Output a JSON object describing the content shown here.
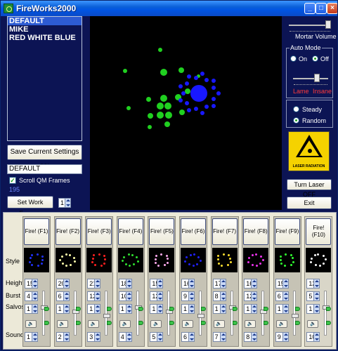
{
  "window": {
    "title": "FireWorks2000",
    "minimize": "_",
    "maximize": "□",
    "close": "×"
  },
  "presets": {
    "items": [
      "DEFAULT",
      "MIKE",
      "RED WHITE BLUE"
    ]
  },
  "left": {
    "save_label": "Save Current Settings as:",
    "setting_name": "DEFAULT",
    "scroll_label": "Scroll QM Frames",
    "frame_count": "195",
    "set_work_frame_label": "Set Work Frame>",
    "work_frame_value": "1"
  },
  "right": {
    "mortar_volume_label": "Mortar Volume",
    "auto_mode_label": "Auto Mode",
    "on_label": "On",
    "off_label": "Off",
    "lame_label": "Lame",
    "insane_label": "Insane",
    "steady_label": "Steady",
    "random_label": "Random",
    "laser_caption": "LASER RADIATION",
    "turn_laser_label": "Turn Laser OFF",
    "exit_label": "Exit"
  },
  "colors": {
    "accent_red": "#ff3a3a",
    "list_select": "#2d5bd3",
    "preview_green": "#20d020",
    "preview_blue": "#1818ff"
  },
  "rows": {
    "style": "Style",
    "height": "Height",
    "burst": "Burst",
    "salvos": "Salvos",
    "sound": "Sound"
  },
  "sound_icon": "speaker-icon",
  "channels": [
    {
      "fire": "Fire! (F1)",
      "height": "15",
      "burst": "4",
      "salvos": "1",
      "sound": "1"
    },
    {
      "fire": "Fire! (F2)",
      "height": "20",
      "burst": "6",
      "salvos": "1",
      "sound": "2"
    },
    {
      "fire": "Fire! (F3)",
      "height": "21",
      "burst": "12",
      "salvos": "1",
      "sound": "3"
    },
    {
      "fire": "Fire! (F4)",
      "height": "18",
      "burst": "10",
      "salvos": "1",
      "sound": "4"
    },
    {
      "fire": "Fire! (F5)",
      "height": "15",
      "burst": "12",
      "salvos": "1",
      "sound": "5"
    },
    {
      "fire": "Fire! (F6)",
      "height": "16",
      "burst": "9",
      "salvos": "1",
      "sound": "6"
    },
    {
      "fire": "Fire! (F7)",
      "height": "17",
      "burst": "8",
      "salvos": "1",
      "sound": "7"
    },
    {
      "fire": "Fire! (F8)",
      "height": "16",
      "burst": "12",
      "salvos": "1",
      "sound": "8"
    },
    {
      "fire": "Fire! (F9)",
      "height": "15",
      "burst": "6",
      "salvos": "1",
      "sound": "9"
    },
    {
      "fire": "Fire! (F10)",
      "height": "12",
      "burst": "5",
      "salvos": "1",
      "sound": "10"
    }
  ]
}
